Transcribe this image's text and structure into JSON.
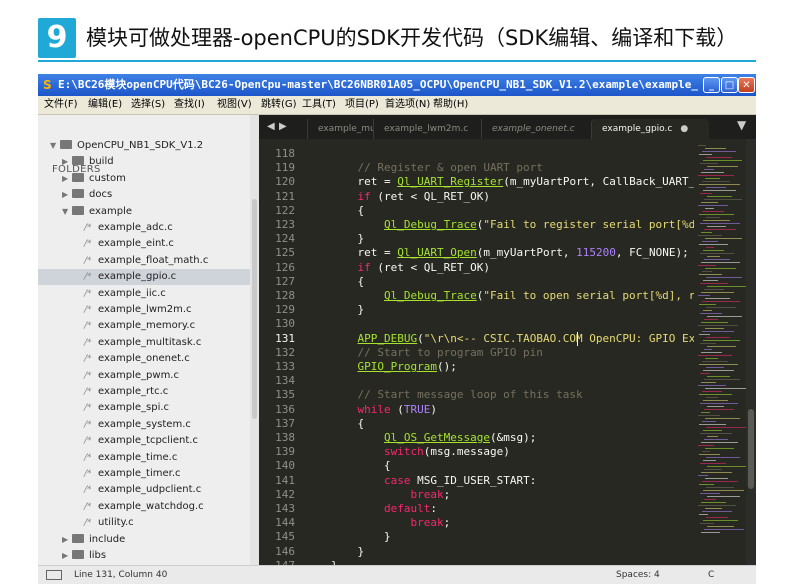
{
  "heading": {
    "step": "9",
    "title": "模块可做处理器-openCPU的SDK开发代码（SDK编辑、编译和下载）"
  },
  "window": {
    "title": "E:\\BC26模块openCPU代码\\BC26-OpenCpu-master\\BC26NBR01A05_OCPU\\OpenCPU_NB1_SDK_V1.2\\example\\example_gp...",
    "buttons": {
      "minimize": "_",
      "maximize": "□",
      "close": "✕"
    }
  },
  "menu": [
    "文件(F)",
    "编辑(E)",
    "选择(S)",
    "查找(I)",
    "视图(V)",
    "跳转(G)",
    "工具(T)",
    "项目(P)",
    "首选项(N)",
    "帮助(H)"
  ],
  "sidebar": {
    "header": "FOLDERS",
    "root": "OpenCPU_NB1_SDK_V1.2",
    "folders_top": [
      "build",
      "custom",
      "docs"
    ],
    "example_folder": "example",
    "files": [
      "example_adc.c",
      "example_eint.c",
      "example_float_math.c",
      "example_gpio.c",
      "example_iic.c",
      "example_lwm2m.c",
      "example_memory.c",
      "example_multitask.c",
      "example_onenet.c",
      "example_pwm.c",
      "example_rtc.c",
      "example_spi.c",
      "example_system.c",
      "example_tcpclient.c",
      "example_time.c",
      "example_timer.c",
      "example_udpclient.c",
      "example_watchdog.c",
      "utility.c"
    ],
    "selected_file": "example_gpio.c",
    "folders_bottom": [
      "include",
      "libs"
    ]
  },
  "tabs": [
    "example_mul",
    "example_lwm2m.c",
    "example_onenet.c",
    "example_gpio.c"
  ],
  "active_tab": "example_gpio.c",
  "editor": {
    "line_numbers": [
      "118",
      "119",
      "120",
      "121",
      "122",
      "123",
      "124",
      "125",
      "126",
      "127",
      "128",
      "129",
      "130",
      "131",
      "132",
      "133",
      "134",
      "135",
      "136",
      "137",
      "138",
      "139",
      "140",
      "141",
      "142",
      "143",
      "144",
      "145",
      "146",
      "147"
    ],
    "code": [
      "",
      "    // Register & open UART port",
      "    ret = Ql_UART_Register(m_myUartPort, CallBack_UART_Hdlr, NU",
      "    if (ret < QL_RET_OK)",
      "    {",
      "        Ql_Debug_Trace(\"Fail to register serial port[%d], ret=%",
      "    }",
      "    ret = Ql_UART_Open(m_myUartPort, 115200, FC_NONE);",
      "    if (ret < QL_RET_OK)",
      "    {",
      "        Ql_Debug_Trace(\"Fail to open serial port[%d], ret=%d\\r\\",
      "    }",
      "",
      "    APP_DEBUG(\"\\r\\n<-- CSIC.TAOBAO.COM OpenCPU: GPIO Example --",
      "    // Start to program GPIO pin",
      "    GPIO_Program();",
      "",
      "    // Start message loop of this task",
      "    while (TRUE)",
      "    {",
      "        Ql_OS_GetMessage(&msg);",
      "        switch(msg.message)",
      "        {",
      "        case MSG_ID_USER_START:",
      "            break;",
      "        default:",
      "            break;",
      "        }",
      "    }",
      "}"
    ]
  },
  "status": {
    "position": "Line 131, Column 40",
    "spaces": "Spaces: 4",
    "syntax": "C"
  },
  "colors": {
    "accent": "#20a9d6",
    "editor_bg": "#272822",
    "comment": "#75715e",
    "keyword": "#f92672",
    "function": "#a6e22e",
    "number": "#ae81ff"
  }
}
